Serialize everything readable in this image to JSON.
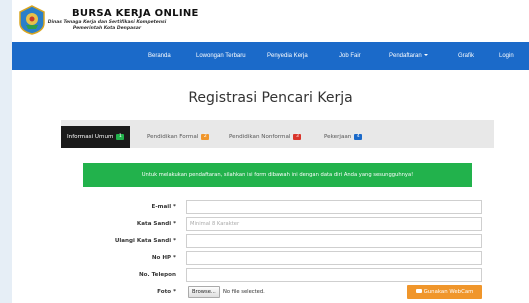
{
  "header": {
    "title": "BURSA KERJA ONLINE",
    "subtitle_line1": "Dinas Tenaga Kerja dan Sertifikasi Kompetensi",
    "subtitle_line2": "Pemerintah Kota Denpasar",
    "logo_icon": "city-emblem-icon"
  },
  "nav": {
    "items": [
      "Beranda",
      "Lowongan Terbaru",
      "Penyedia Kerja",
      "Job Fair",
      "Pendaftaran",
      "Grafik",
      "Login"
    ],
    "color": "#1b6ac9"
  },
  "page_title": "Registrasi Pencari Kerja",
  "tabs": [
    {
      "label": "Informasi Umum",
      "badge": "1",
      "badge_color": "#22b24c"
    },
    {
      "label": "Pendidikan Formal",
      "badge": "2",
      "badge_color": "#f0962b"
    },
    {
      "label": "Pendidikan Nonformal",
      "badge": "3",
      "badge_color": "#d9342b"
    },
    {
      "label": "Pekerjaan",
      "badge": "4",
      "badge_color": "#1b6ac9"
    }
  ],
  "alert": "Untuk melakukan pendaftaran, silahkan isi form dibawah ini dengan data diri Anda yang sesungguhnya!",
  "form": {
    "email_label": "E-mail *",
    "password_label": "Kata Sandi *",
    "password_placeholder": "Minimal 8 Karakter",
    "repeat_password_label": "Ulangi Kata Sandi *",
    "phone_label": "No HP *",
    "telephone_label": "No. Telepon",
    "photo_label": "Foto *",
    "browse_label": "Browse...",
    "file_status": "No file selected.",
    "webcam_label": "Gunakan WebCam"
  },
  "colors": {
    "alert_green": "#22b24c",
    "webcam_orange": "#f0962b"
  }
}
